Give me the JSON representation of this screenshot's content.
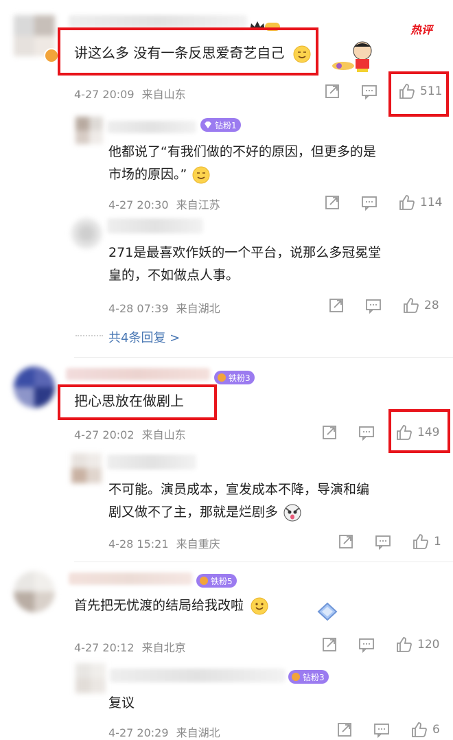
{
  "hot_badge": "热评",
  "comments": [
    {
      "text": "讲这么多 没有一条反思爱奇艺自己",
      "time": "4-27 20:09",
      "location": "来自山东",
      "likes": "511",
      "fan_badge": "",
      "replies": [
        {
          "text_line1": "他都说了“有我们做的不好的原因，但更多的是",
          "text_line2": "市场的原因。”",
          "badge": "钻粉1",
          "time": "4-27 20:30",
          "location": "来自江苏",
          "likes": "114"
        },
        {
          "text_line1": "271是最喜欢作妖的一个平台，说那么多冠冕堂",
          "text_line2": "皇的，不如做点人事。",
          "badge": "",
          "time": "4-28 07:39",
          "location": "来自湖北",
          "likes": "28"
        }
      ],
      "more_replies": "共4条回复 >"
    },
    {
      "text": "把心思放在做剧上",
      "time": "4-27 20:02",
      "location": "来自山东",
      "likes": "149",
      "fan_badge": "铁粉3",
      "replies": [
        {
          "text_line1": "不可能。演员成本，宣发成本不降，导演和编",
          "text_line2": "剧又做不了主，那就是烂剧多",
          "badge": "",
          "time": "4-28 15:21",
          "location": "来自重庆",
          "likes": "1"
        }
      ]
    },
    {
      "text": "首先把无忧渡的结局给我改啦",
      "time": "4-27 20:12",
      "location": "来自北京",
      "likes": "120",
      "fan_badge": "铁粉5",
      "replies": [
        {
          "text_line1": "复议",
          "badge": "钻粉3",
          "time": "4-27 20:29",
          "location": "来自湖北",
          "likes": "6"
        }
      ]
    }
  ],
  "colors": {
    "highlight_box": "#e8141b",
    "link": "#4a78b4",
    "meta_gray": "#8a8a8a",
    "badge_purple": "#9b7bf0",
    "badge_orange": "#f2a43a",
    "hot_red": "#e8141b"
  },
  "icons": [
    "share-icon",
    "comment-icon",
    "thumbs-up-icon",
    "smile-emoji-icon",
    "dog-emoji-icon",
    "crayon-shinchan-sticker-icon"
  ]
}
